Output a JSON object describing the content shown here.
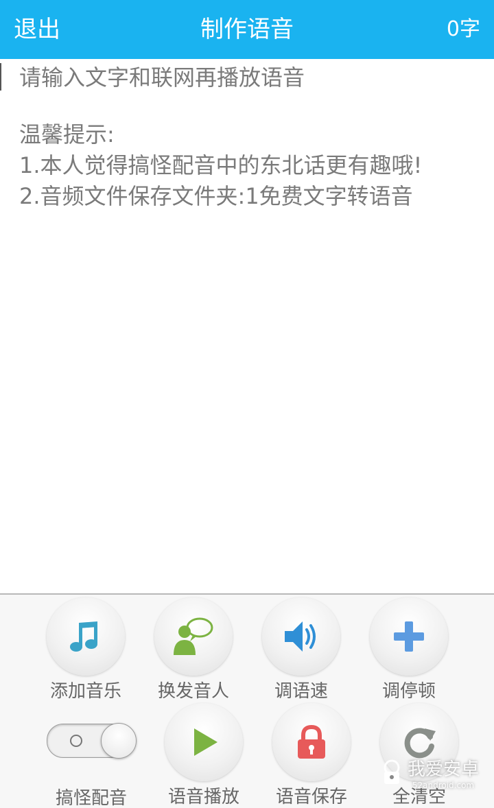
{
  "header": {
    "left": "退出",
    "title": "制作语音",
    "right": "0字"
  },
  "editor": {
    "placeholder": "请输入文字和联网再播放语音",
    "tips_title": "温馨提示:",
    "tips": [
      "1.本人觉得搞怪配音中的东北话更有趣哦!",
      "2.音频文件保存文件夹:1免费文字转语音"
    ]
  },
  "toolbar": {
    "row1": [
      {
        "label": "添加音乐",
        "icon": "music-note-icon"
      },
      {
        "label": "换发音人",
        "icon": "person-speech-icon"
      },
      {
        "label": "调语速",
        "icon": "speaker-icon"
      },
      {
        "label": "调停顿",
        "icon": "plus-icon"
      }
    ],
    "row2": [
      {
        "label": "搞怪配音",
        "icon": "toggle-switch",
        "state": "off"
      },
      {
        "label": "语音播放",
        "icon": "play-icon"
      },
      {
        "label": "语音保存",
        "icon": "lock-icon"
      },
      {
        "label": "全清空",
        "icon": "refresh-icon"
      }
    ]
  },
  "watermark": {
    "text": "我爱安卓",
    "sub": "52android.com"
  },
  "colors": {
    "header_bg": "#1ab3f0",
    "music": "#3aa3c8",
    "person": "#7cb342",
    "speaker": "#2f8fd6",
    "plus": "#5c9be0",
    "play": "#7cb342",
    "lock": "#e75a5a",
    "refresh": "#8a8f8a"
  }
}
